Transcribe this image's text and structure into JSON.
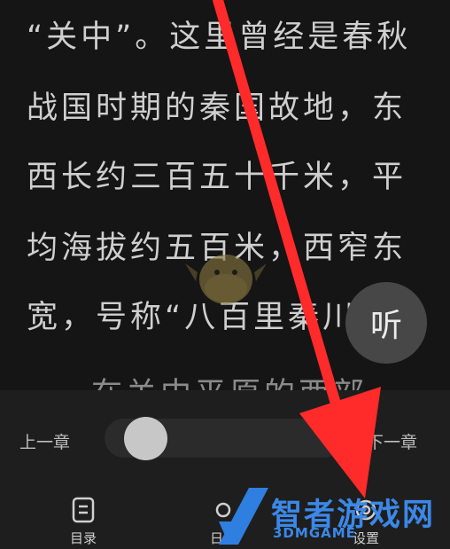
{
  "reader": {
    "lines": [
      "“关中”。这里曾经是春秋",
      "战国时期的秦国故地，东",
      "西长约三百五十千米，平",
      "均海拔约五百米，西窄东",
      "宽，号称“八百里秦川”",
      "在关中平原的西部"
    ],
    "listen_label": "听"
  },
  "controls": {
    "prev_chapter": "上一章",
    "next_chapter": "下一章",
    "progress": 0.1
  },
  "tabs": [
    {
      "label": "目录",
      "icon": "catalog-icon"
    },
    {
      "label": "日间",
      "icon": "daylight-icon"
    },
    {
      "label": "设置",
      "icon": "settings-icon"
    }
  ],
  "watermark": {
    "brand": "智者游戏网",
    "sub": "3DMGAME"
  },
  "colors": {
    "background": "#151515",
    "panel": "#1e1e1e",
    "arrow": "#ff2a2a",
    "watermark": "#3b88e8"
  }
}
